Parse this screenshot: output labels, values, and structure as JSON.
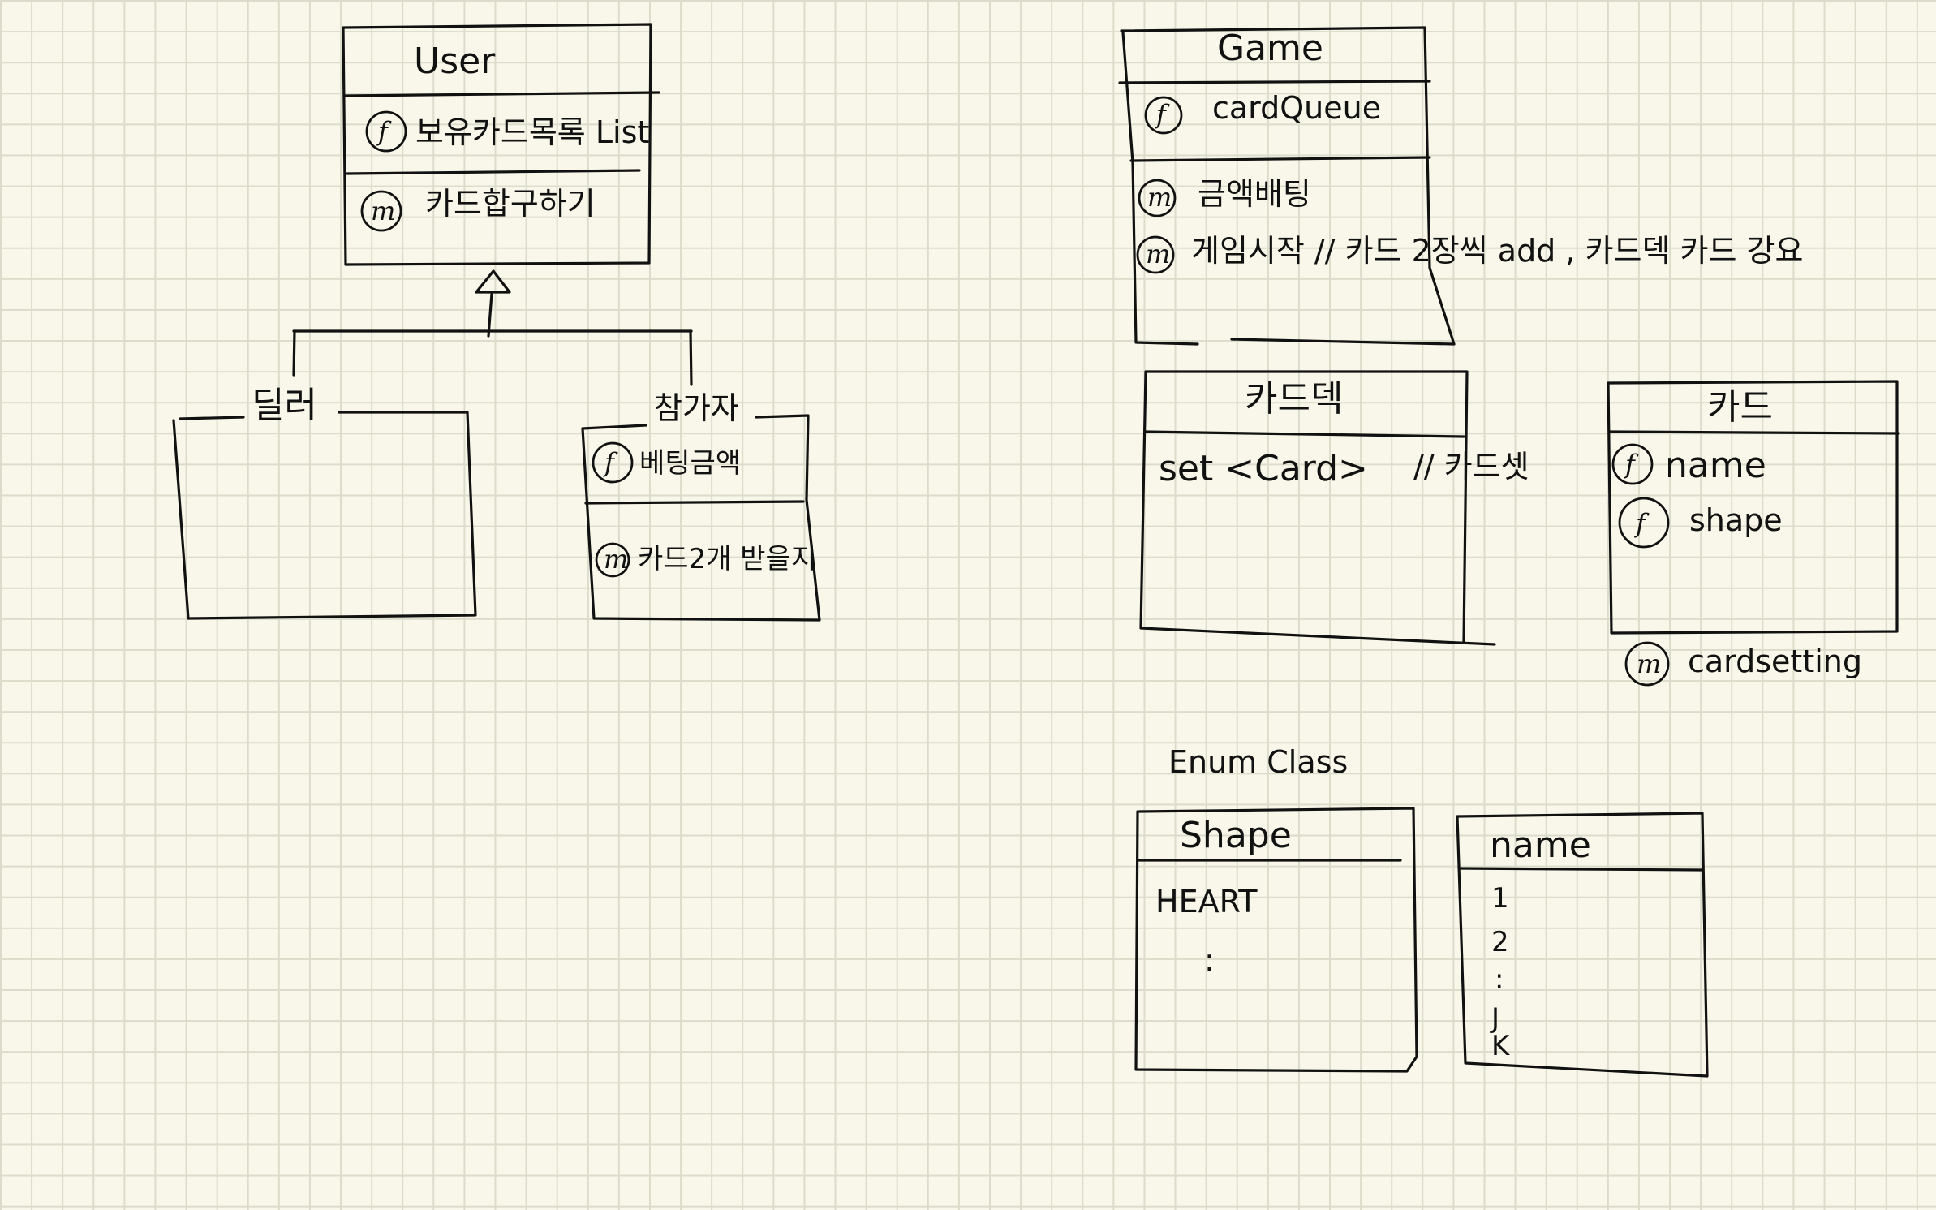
{
  "user_class": {
    "title": "User",
    "field_badge": "f",
    "field": "보유카드목록 List",
    "method_badge": "m",
    "method": "카드합구하기"
  },
  "dealer_class": {
    "title": "딜러"
  },
  "player_class": {
    "title": "참가자",
    "field_badge": "f",
    "field": "베팅금액",
    "method_badge": "m",
    "method": "카드2개 받을지"
  },
  "game_class": {
    "title": "Game",
    "field_badge": "f",
    "field": "cardQueue",
    "method1_badge": "m",
    "method1": "금액배팅",
    "method2_badge": "m",
    "method2": "게임시작 // 카드 2장씩 add , 카드덱 카드 강요"
  },
  "deck_class": {
    "title": "카드덱",
    "field": "set <Card>",
    "comment": "// 카드셋"
  },
  "card_class": {
    "title": "카드",
    "field1_badge": "f",
    "field1": "name",
    "field2_badge": "f",
    "field2": "shape",
    "method_badge": "m",
    "method": "cardsetting"
  },
  "enum_section": {
    "label": "Enum Class"
  },
  "shape_enum": {
    "title": "Shape",
    "values": [
      "HEART",
      ":"
    ]
  },
  "name_enum": {
    "title": "name",
    "values": [
      "1",
      "2",
      ":",
      "J",
      "K"
    ]
  }
}
